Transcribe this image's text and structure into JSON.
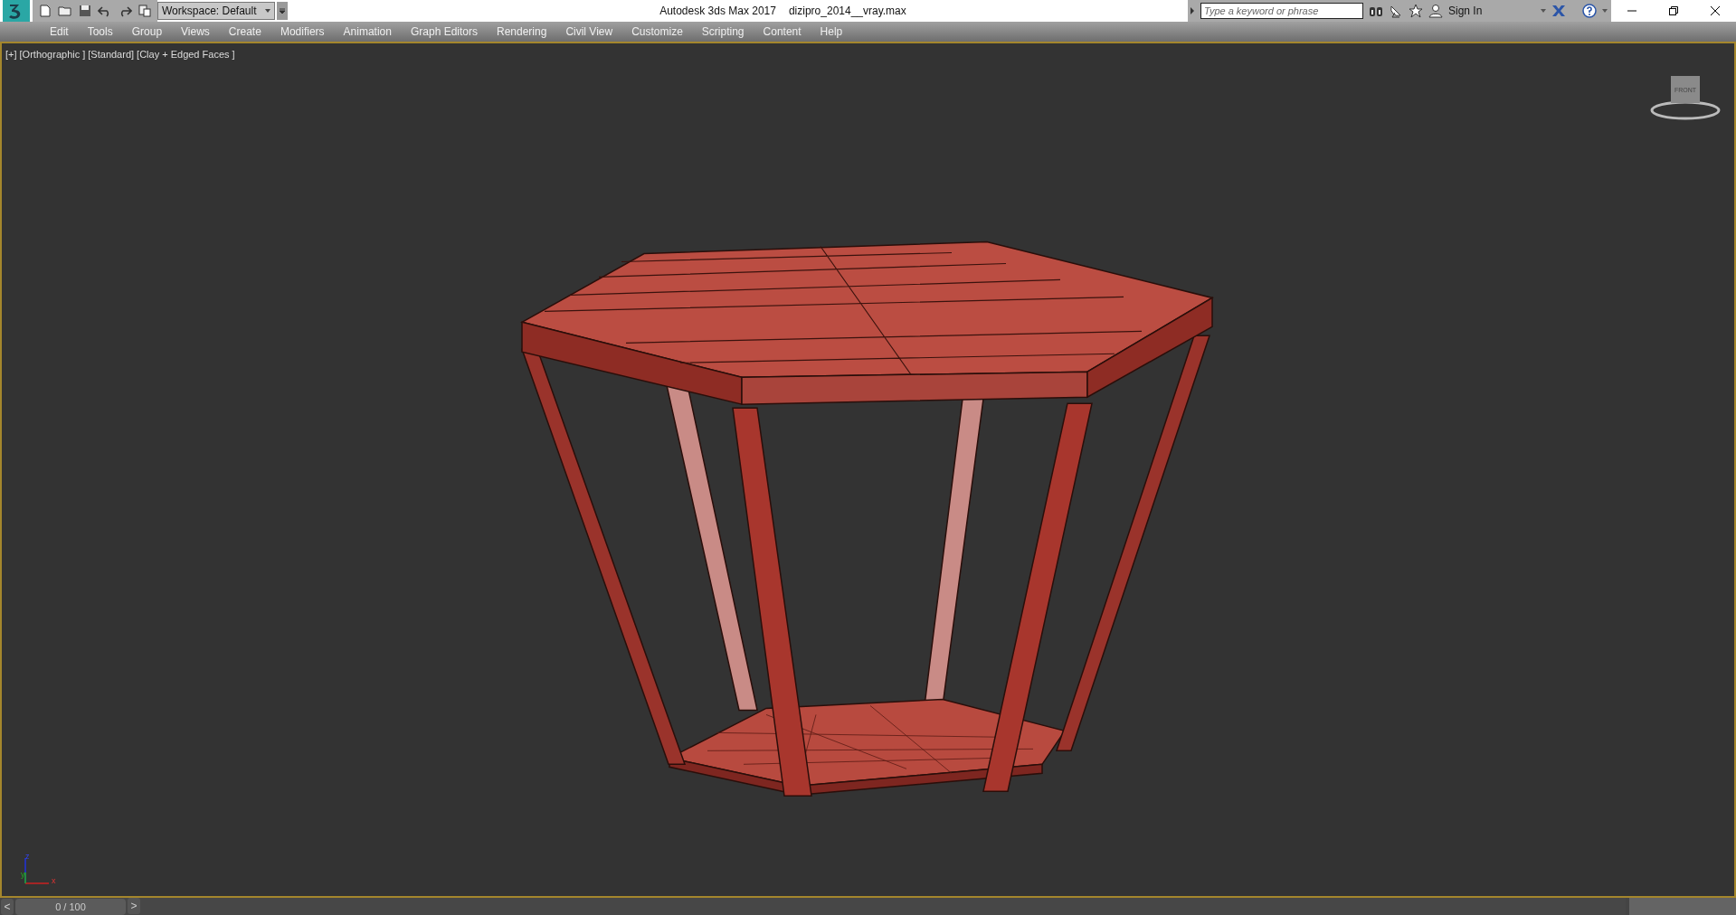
{
  "title_bar": {
    "workspace": "Workspace: Default",
    "app_title": "Autodesk 3ds Max 2017",
    "file_name": "dizipro_2014__vray.max",
    "search": {
      "placeholder": "Type a keyword or phrase"
    },
    "sign_in": "Sign In"
  },
  "menu_bar": {
    "items": [
      "Edit",
      "Tools",
      "Group",
      "Views",
      "Create",
      "Modifiers",
      "Animation",
      "Graph Editors",
      "Rendering",
      "Civil View",
      "Customize",
      "Scripting",
      "Content",
      "Help"
    ]
  },
  "viewport": {
    "labels": [
      "[+]",
      "[Orthographic ]",
      "[Standard]",
      "[Clay + Edged Faces ]"
    ],
    "view_cube": "FRONT",
    "axes": [
      "z",
      "y",
      "x"
    ]
  },
  "time_slider": {
    "prev": "<",
    "frame": "0 / 100",
    "next": ">",
    "level": 0
  }
}
